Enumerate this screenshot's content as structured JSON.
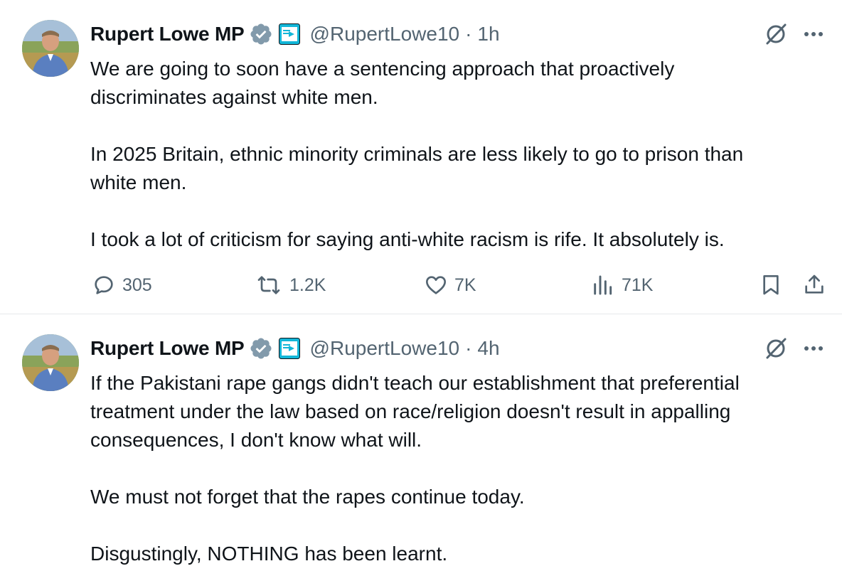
{
  "tweets": [
    {
      "author": {
        "name": "Rupert Lowe MP",
        "handle": "@RupertLowe10",
        "verified": true,
        "affiliate_badge": "reform-uk-badge"
      },
      "time": "1h",
      "text": "We are going to soon have a sentencing approach that proactively\ndiscriminates against white men.\n\nIn 2025 Britain, ethnic minority criminals are less likely to go to prison than\nwhite men.\n\nI took a lot of criticism for saying anti-white racism is rife. It absolutely is.",
      "actions": {
        "replies": "305",
        "reposts": "1.2K",
        "likes": "7K",
        "views": "71K"
      }
    },
    {
      "author": {
        "name": "Rupert Lowe MP",
        "handle": "@RupertLowe10",
        "verified": true,
        "affiliate_badge": "reform-uk-badge"
      },
      "time": "4h",
      "text": "If the Pakistani rape gangs didn't teach our establishment that preferential\ntreatment under the law based on race/religion doesn't result in appalling\nconsequences, I don't know what will.\n\nWe must not forget that the rapes continue today.\n\nDisgustingly, NOTHING has been learnt."
    }
  ],
  "separator": "·",
  "colors": {
    "text": "#0f1419",
    "secondary": "#536471",
    "verified_badge": "#829aab",
    "affiliate_badge": "#12b6d8",
    "divider": "#e6e9eb"
  },
  "icons": [
    "grok-icon",
    "more-icon",
    "reply-icon",
    "repost-icon",
    "like-icon",
    "views-icon",
    "bookmark-icon",
    "share-icon"
  ]
}
